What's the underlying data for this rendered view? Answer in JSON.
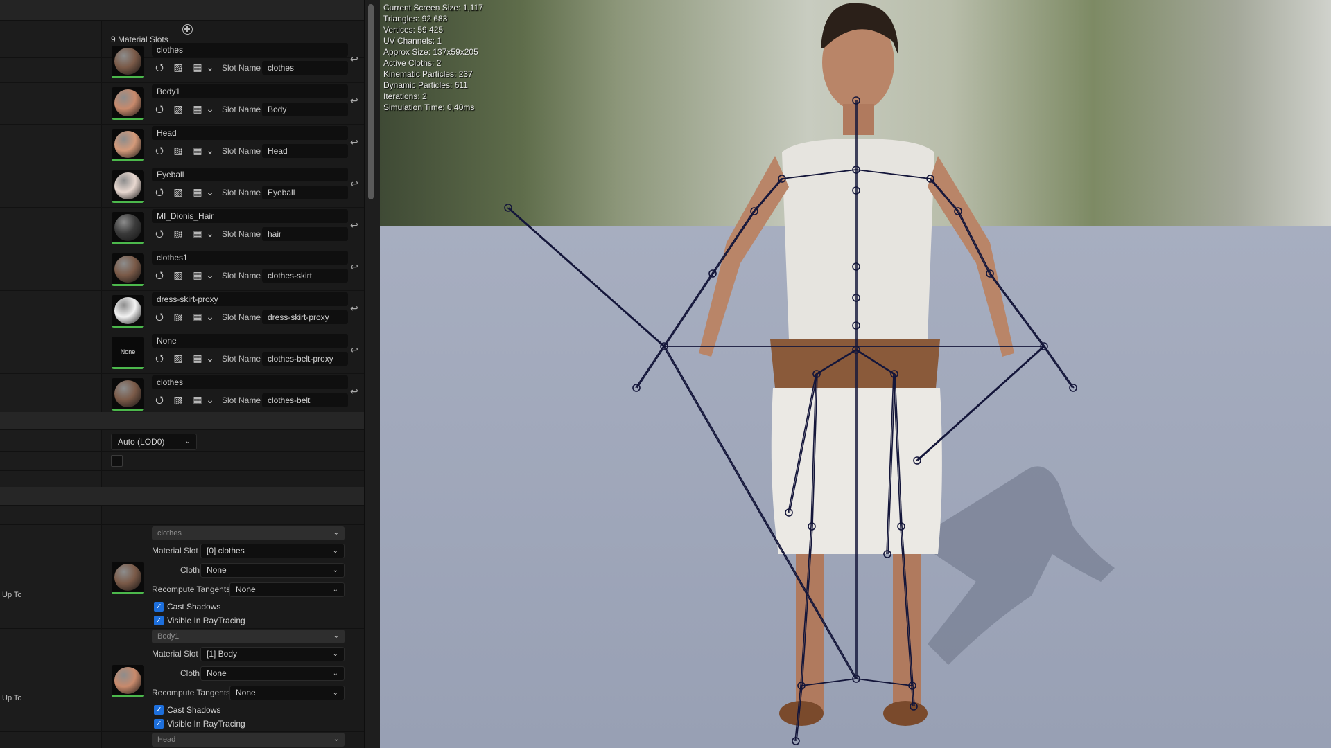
{
  "details": {
    "material_slots_header": "9 Material Slots",
    "slot_name_label": "Slot Name",
    "slots": [
      {
        "material": "clothes",
        "slot_name": "clothes",
        "thumb_color": "#7a5a48"
      },
      {
        "material": "Body1",
        "slot_name": "Body",
        "thumb_color": "#c88a6c"
      },
      {
        "material": "Head",
        "slot_name": "Head",
        "thumb_color": "#d49a7a"
      },
      {
        "material": "Eyeball",
        "slot_name": "Eyeball",
        "thumb_color": "#e8d8d0"
      },
      {
        "material": "MI_Dionis_Hair",
        "slot_name": "hair",
        "thumb_color": "#3a3a3a"
      },
      {
        "material": "clothes1",
        "slot_name": "clothes-skirt",
        "thumb_color": "#7a5a48"
      },
      {
        "material": "dress-skirt-proxy",
        "slot_name": "dress-skirt-proxy",
        "thumb_color": "#f2f2f2"
      },
      {
        "material": "None",
        "slot_name": "clothes-belt-proxy",
        "thumb_color": "#0a0a0a",
        "thumb_text": "None"
      },
      {
        "material": "clothes",
        "slot_name": "clothes-belt",
        "thumb_color": "#7a5a48"
      }
    ],
    "lod_dropdown": "Auto (LOD0)",
    "sections": [
      {
        "up_to": "Up To",
        "section_dd": "clothes",
        "material_slot_label": "Material Slot",
        "material_slot": "[0] clothes",
        "clothing_label": "Clothing",
        "clothing": "None",
        "recompute_label": "Recompute Tangents",
        "recompute": "None",
        "cast_shadows": "Cast Shadows",
        "visible_rt": "Visible In RayTracing",
        "thumb_color": "#7a5a48"
      },
      {
        "up_to": "Up To",
        "section_dd": "Body1",
        "material_slot_label": "Material Slot",
        "material_slot": "[1] Body",
        "clothing_label": "Clothing",
        "clothing": "None",
        "recompute_label": "Recompute Tangents",
        "recompute": "None",
        "cast_shadows": "Cast Shadows",
        "visible_rt": "Visible In RayTracing",
        "thumb_color": "#c88a6c"
      }
    ],
    "third_section_dd": "Head"
  },
  "viewport": {
    "stats": [
      "Current Screen Size: 1,117",
      "Triangles: 92 683",
      "Vertices: 59 425",
      "UV Channels: 1",
      "Approx Size: 137x59x205",
      "Active Cloths: 2",
      "Kinematic Particles: 237",
      "Dynamic Particles: 611",
      "Iterations: 2",
      "Simulation Time: 0,40ms"
    ],
    "skeleton_color": "#14163a"
  }
}
